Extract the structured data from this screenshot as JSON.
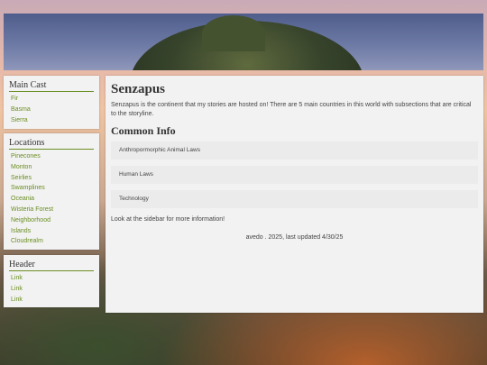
{
  "sidebar": {
    "main_cast": {
      "title": "Main Cast",
      "items": [
        "Fir",
        "Basma",
        "Sierra"
      ]
    },
    "locations": {
      "title": "Locations",
      "items": [
        "Pinecones",
        "Monton",
        "Seirlies",
        "Swamplines",
        "Oceania",
        "Wisteria Forest",
        "Neighborhood",
        "Islands",
        "Cloudrealm"
      ]
    },
    "header_box": {
      "title": "Header",
      "items": [
        "Link",
        "Link",
        "Link"
      ]
    }
  },
  "main": {
    "title": "Senzapus",
    "intro": "Senzapus is the continent that my stories are hosted on! There are 5 main countries in this world with subsections that are critical to the storyline.",
    "common_info": {
      "title": "Common Info",
      "items": [
        "Anthropormorphic Animal Laws",
        "Human Laws",
        "Technology"
      ]
    },
    "note": "Look at the sidebar for more information!",
    "footer": "avedo . 2025, last updated 4/30/25"
  }
}
